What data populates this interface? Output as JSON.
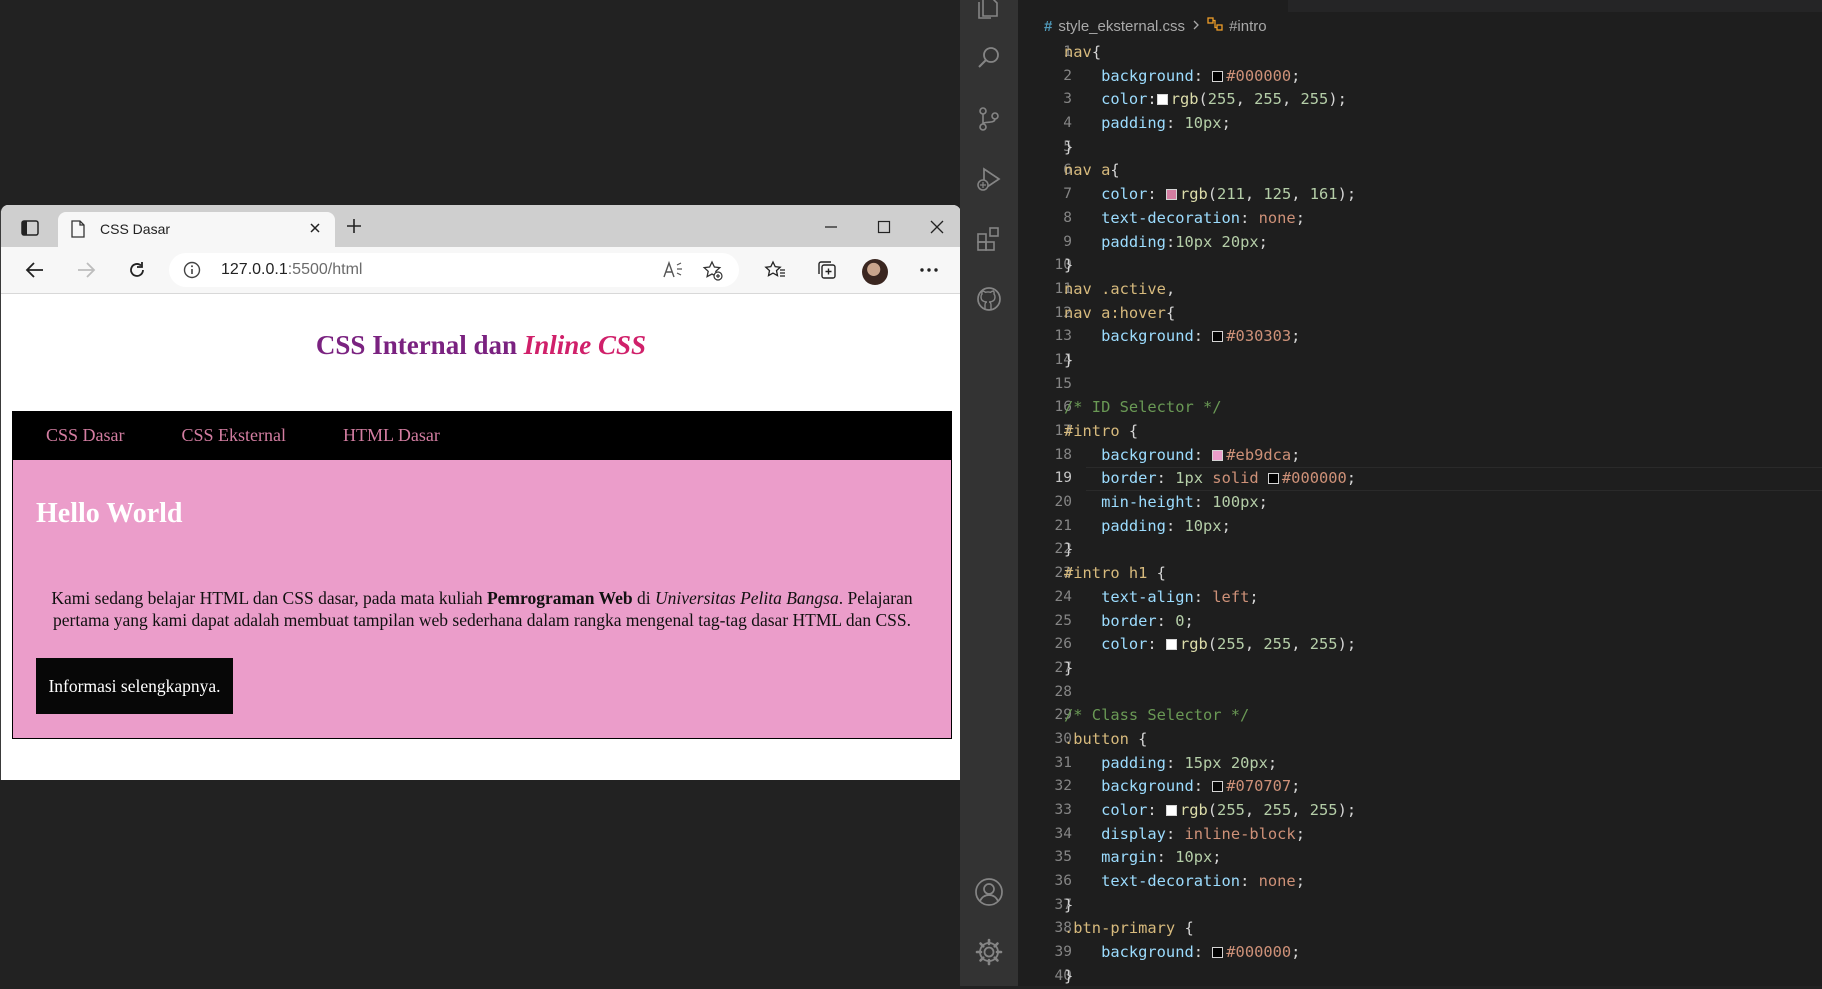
{
  "browser": {
    "tab_title": "CSS Dasar",
    "url_host": "127.0.0.1",
    "url_rest": ":5500/html"
  },
  "page": {
    "heading_text": "CSS Internal dan ",
    "heading_italic": "Inline CSS",
    "nav": [
      "CSS Dasar",
      "CSS Eksternal",
      "HTML Dasar"
    ],
    "intro_title": "Hello World",
    "para_1": "Kami sedang belajar HTML dan CSS dasar, pada mata kuliah ",
    "para_bold": "Pemrograman Web",
    "para_2": " di ",
    "para_italic": "Universitas Pelita Bangsa",
    "para_3": ". Pelajaran pertama yang kami dapat adalah membuat tampilan web sederhana dalam rangka mengenal tag-tag dasar HTML dan CSS.",
    "button": "Informasi selengkapnya."
  },
  "editor": {
    "breadcrumb_file": "style_eksternal.css",
    "breadcrumb_symbol": "#intro",
    "current_line": 19,
    "lines": [
      [
        {
          "t": "nav",
          "c": "#d7ba7d"
        },
        {
          "t": "{",
          "c": "#d4d4d4"
        }
      ],
      [
        {
          "t": "    background",
          "c": "#9cdcfe"
        },
        {
          "t": ": ",
          "c": "#d4d4d4"
        },
        {
          "sw": "#000000"
        },
        {
          "t": "#000000",
          "c": "#ce9178"
        },
        {
          "t": ";",
          "c": "#d4d4d4"
        }
      ],
      [
        {
          "t": "    color",
          "c": "#9cdcfe"
        },
        {
          "t": ":",
          "c": "#d4d4d4"
        },
        {
          "sw": "#ffffff"
        },
        {
          "t": "rgb",
          "c": "#dcdcaa"
        },
        {
          "t": "(",
          "c": "#d4d4d4"
        },
        {
          "t": "255",
          "c": "#b5cea8"
        },
        {
          "t": ", ",
          "c": "#d4d4d4"
        },
        {
          "t": "255",
          "c": "#b5cea8"
        },
        {
          "t": ", ",
          "c": "#d4d4d4"
        },
        {
          "t": "255",
          "c": "#b5cea8"
        },
        {
          "t": ");",
          "c": "#d4d4d4"
        }
      ],
      [
        {
          "t": "    padding",
          "c": "#9cdcfe"
        },
        {
          "t": ": ",
          "c": "#d4d4d4"
        },
        {
          "t": "10px",
          "c": "#b5cea8"
        },
        {
          "t": ";",
          "c": "#d4d4d4"
        }
      ],
      [
        {
          "t": "}",
          "c": "#d4d4d4"
        }
      ],
      [
        {
          "t": "nav a",
          "c": "#d7ba7d"
        },
        {
          "t": "{",
          "c": "#d4d4d4"
        }
      ],
      [
        {
          "t": "    color",
          "c": "#9cdcfe"
        },
        {
          "t": ": ",
          "c": "#d4d4d4"
        },
        {
          "sw": "#d37da1"
        },
        {
          "t": "rgb",
          "c": "#dcdcaa"
        },
        {
          "t": "(",
          "c": "#d4d4d4"
        },
        {
          "t": "211",
          "c": "#b5cea8"
        },
        {
          "t": ", ",
          "c": "#d4d4d4"
        },
        {
          "t": "125",
          "c": "#b5cea8"
        },
        {
          "t": ", ",
          "c": "#d4d4d4"
        },
        {
          "t": "161",
          "c": "#b5cea8"
        },
        {
          "t": ");",
          "c": "#d4d4d4"
        }
      ],
      [
        {
          "t": "    text-decoration",
          "c": "#9cdcfe"
        },
        {
          "t": ": ",
          "c": "#d4d4d4"
        },
        {
          "t": "none",
          "c": "#ce9178"
        },
        {
          "t": ";",
          "c": "#d4d4d4"
        }
      ],
      [
        {
          "t": "    padding",
          "c": "#9cdcfe"
        },
        {
          "t": ":",
          "c": "#d4d4d4"
        },
        {
          "t": "10px 20px",
          "c": "#b5cea8"
        },
        {
          "t": ";",
          "c": "#d4d4d4"
        }
      ],
      [
        {
          "t": "}",
          "c": "#d4d4d4"
        }
      ],
      [
        {
          "t": "nav .active",
          "c": "#d7ba7d"
        },
        {
          "t": ",",
          "c": "#d4d4d4"
        }
      ],
      [
        {
          "t": "nav a:hover",
          "c": "#d7ba7d"
        },
        {
          "t": "{",
          "c": "#d4d4d4"
        }
      ],
      [
        {
          "t": "    background",
          "c": "#9cdcfe"
        },
        {
          "t": ": ",
          "c": "#d4d4d4"
        },
        {
          "sw": "#030303"
        },
        {
          "t": "#030303",
          "c": "#ce9178"
        },
        {
          "t": ";",
          "c": "#d4d4d4"
        }
      ],
      [
        {
          "t": "}",
          "c": "#d4d4d4"
        }
      ],
      [],
      [
        {
          "t": "/* ID Selector */",
          "c": "#6a9955"
        }
      ],
      [
        {
          "t": "#intro",
          "c": "#d7ba7d"
        },
        {
          "t": " {",
          "c": "#d4d4d4"
        }
      ],
      [
        {
          "t": "    background",
          "c": "#9cdcfe"
        },
        {
          "t": ": ",
          "c": "#d4d4d4"
        },
        {
          "sw": "#eb9dca"
        },
        {
          "t": "#eb9dca",
          "c": "#ce9178"
        },
        {
          "t": ";",
          "c": "#d4d4d4"
        }
      ],
      [
        {
          "t": "    border",
          "c": "#9cdcfe"
        },
        {
          "t": ": ",
          "c": "#d4d4d4"
        },
        {
          "t": "1px",
          "c": "#b5cea8"
        },
        {
          "t": " solid ",
          "c": "#ce9178"
        },
        {
          "sw": "#000000"
        },
        {
          "t": "#000000",
          "c": "#ce9178"
        },
        {
          "t": ";",
          "c": "#d4d4d4"
        }
      ],
      [
        {
          "t": "    min-height",
          "c": "#9cdcfe"
        },
        {
          "t": ": ",
          "c": "#d4d4d4"
        },
        {
          "t": "100px",
          "c": "#b5cea8"
        },
        {
          "t": ";",
          "c": "#d4d4d4"
        }
      ],
      [
        {
          "t": "    padding",
          "c": "#9cdcfe"
        },
        {
          "t": ": ",
          "c": "#d4d4d4"
        },
        {
          "t": "10px",
          "c": "#b5cea8"
        },
        {
          "t": ";",
          "c": "#d4d4d4"
        }
      ],
      [
        {
          "t": "}",
          "c": "#d4d4d4"
        }
      ],
      [
        {
          "t": "#intro h1",
          "c": "#d7ba7d"
        },
        {
          "t": " {",
          "c": "#d4d4d4"
        }
      ],
      [
        {
          "t": "    text-align",
          "c": "#9cdcfe"
        },
        {
          "t": ": ",
          "c": "#d4d4d4"
        },
        {
          "t": "left",
          "c": "#ce9178"
        },
        {
          "t": ";",
          "c": "#d4d4d4"
        }
      ],
      [
        {
          "t": "    border",
          "c": "#9cdcfe"
        },
        {
          "t": ": ",
          "c": "#d4d4d4"
        },
        {
          "t": "0",
          "c": "#b5cea8"
        },
        {
          "t": ";",
          "c": "#d4d4d4"
        }
      ],
      [
        {
          "t": "    color",
          "c": "#9cdcfe"
        },
        {
          "t": ": ",
          "c": "#d4d4d4"
        },
        {
          "sw": "#ffffff"
        },
        {
          "t": "rgb",
          "c": "#dcdcaa"
        },
        {
          "t": "(",
          "c": "#d4d4d4"
        },
        {
          "t": "255",
          "c": "#b5cea8"
        },
        {
          "t": ", ",
          "c": "#d4d4d4"
        },
        {
          "t": "255",
          "c": "#b5cea8"
        },
        {
          "t": ", ",
          "c": "#d4d4d4"
        },
        {
          "t": "255",
          "c": "#b5cea8"
        },
        {
          "t": ");",
          "c": "#d4d4d4"
        }
      ],
      [
        {
          "t": "}",
          "c": "#d4d4d4"
        }
      ],
      [],
      [
        {
          "t": "/* Class Selector */",
          "c": "#6a9955"
        }
      ],
      [
        {
          "t": ".button",
          "c": "#d7ba7d"
        },
        {
          "t": " {",
          "c": "#d4d4d4"
        }
      ],
      [
        {
          "t": "    padding",
          "c": "#9cdcfe"
        },
        {
          "t": ": ",
          "c": "#d4d4d4"
        },
        {
          "t": "15px 20px",
          "c": "#b5cea8"
        },
        {
          "t": ";",
          "c": "#d4d4d4"
        }
      ],
      [
        {
          "t": "    background",
          "c": "#9cdcfe"
        },
        {
          "t": ": ",
          "c": "#d4d4d4"
        },
        {
          "sw": "#070707"
        },
        {
          "t": "#070707",
          "c": "#ce9178"
        },
        {
          "t": ";",
          "c": "#d4d4d4"
        }
      ],
      [
        {
          "t": "    color",
          "c": "#9cdcfe"
        },
        {
          "t": ": ",
          "c": "#d4d4d4"
        },
        {
          "sw": "#ffffff"
        },
        {
          "t": "rgb",
          "c": "#dcdcaa"
        },
        {
          "t": "(",
          "c": "#d4d4d4"
        },
        {
          "t": "255",
          "c": "#b5cea8"
        },
        {
          "t": ", ",
          "c": "#d4d4d4"
        },
        {
          "t": "255",
          "c": "#b5cea8"
        },
        {
          "t": ", ",
          "c": "#d4d4d4"
        },
        {
          "t": "255",
          "c": "#b5cea8"
        },
        {
          "t": ");",
          "c": "#d4d4d4"
        }
      ],
      [
        {
          "t": "    display",
          "c": "#9cdcfe"
        },
        {
          "t": ": ",
          "c": "#d4d4d4"
        },
        {
          "t": "inline-block",
          "c": "#ce9178"
        },
        {
          "t": ";",
          "c": "#d4d4d4"
        }
      ],
      [
        {
          "t": "    margin",
          "c": "#9cdcfe"
        },
        {
          "t": ": ",
          "c": "#d4d4d4"
        },
        {
          "t": "10px",
          "c": "#b5cea8"
        },
        {
          "t": ";",
          "c": "#d4d4d4"
        }
      ],
      [
        {
          "t": "    text-decoration",
          "c": "#9cdcfe"
        },
        {
          "t": ": ",
          "c": "#d4d4d4"
        },
        {
          "t": "none",
          "c": "#ce9178"
        },
        {
          "t": ";",
          "c": "#d4d4d4"
        }
      ],
      [
        {
          "t": "}",
          "c": "#d4d4d4"
        }
      ],
      [
        {
          "t": ".btn-primary",
          "c": "#d7ba7d"
        },
        {
          "t": " {",
          "c": "#d4d4d4"
        }
      ],
      [
        {
          "t": "    background",
          "c": "#9cdcfe"
        },
        {
          "t": ": ",
          "c": "#d4d4d4"
        },
        {
          "sw": "#000000"
        },
        {
          "t": "#000000",
          "c": "#ce9178"
        },
        {
          "t": ";",
          "c": "#d4d4d4"
        }
      ],
      [
        {
          "t": "}",
          "c": "#d4d4d4"
        }
      ]
    ]
  }
}
